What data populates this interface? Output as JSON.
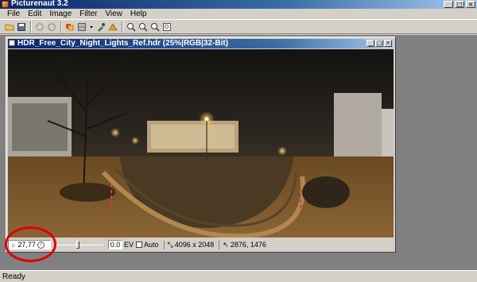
{
  "window": {
    "title": "Picturenaut 3.2"
  },
  "menu": {
    "items": [
      "File",
      "Edit",
      "Image",
      "Filter",
      "View",
      "Help"
    ]
  },
  "toolbar": {
    "tools": [
      "open-folder-icon",
      "save-icon",
      "undo-icon",
      "redo-icon",
      "hdr-generate-icon",
      "grid-view-icon",
      "dropdown-arrow-icon",
      "eyedropper-icon",
      "tonemap-icon",
      "zoom-in-icon",
      "zoom-out-icon",
      "zoom-fit-icon",
      "zoom-actual-icon"
    ]
  },
  "document": {
    "title": "HDR_Free_City_Night_Lights_Ref.hdr (25%|RGB|32-Bit)",
    "exposure_value": "27,77",
    "ev_value": "0.0",
    "ev_label": "EV",
    "auto_label": "Auto",
    "dimensions": "4096 x 2048",
    "cursor_position": "2876, 1476"
  },
  "statusbar": {
    "text": "Ready"
  },
  "colors": {
    "annotation": "#e00000",
    "titlebar_start": "#0a246a",
    "titlebar_end": "#a6caf0"
  }
}
